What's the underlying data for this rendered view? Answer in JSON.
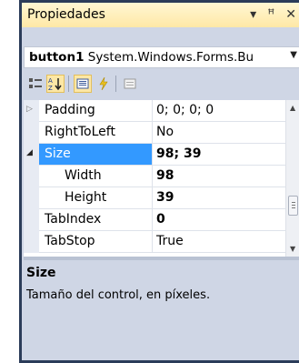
{
  "window": {
    "title": "Propiedades",
    "icons": [
      "dropdown-arrow-icon",
      "pin-icon",
      "close-icon"
    ]
  },
  "object_selector": {
    "name": "button1",
    "type": "System.Windows.Forms.Bu"
  },
  "toolbar": {
    "buttons": [
      "categorized-icon",
      "alphabetical-icon",
      "properties-icon",
      "events-icon",
      "property-pages-icon"
    ]
  },
  "properties": [
    {
      "name": "Padding",
      "value": "0; 0; 0; 0",
      "expander": "closed",
      "bold": false,
      "selected": false,
      "indent": 0
    },
    {
      "name": "RightToLeft",
      "value": "No",
      "expander": "",
      "bold": false,
      "selected": false,
      "indent": 0
    },
    {
      "name": "Size",
      "value": "98; 39",
      "expander": "open",
      "bold": true,
      "selected": true,
      "indent": 0
    },
    {
      "name": "Width",
      "value": "98",
      "expander": "",
      "bold": true,
      "selected": false,
      "indent": 1
    },
    {
      "name": "Height",
      "value": "39",
      "expander": "",
      "bold": true,
      "selected": false,
      "indent": 1
    },
    {
      "name": "TabIndex",
      "value": "0",
      "expander": "",
      "bold": true,
      "selected": false,
      "indent": 0
    },
    {
      "name": "TabStop",
      "value": "True",
      "expander": "",
      "bold": false,
      "selected": false,
      "indent": 0
    }
  ],
  "description": {
    "title": "Size",
    "text": "Tamaño del control, en píxeles."
  },
  "colors": {
    "frame": "#2b3c59",
    "titlebar": "#ffe8a6",
    "selection": "#3399ff",
    "panel": "#cfd6e5"
  }
}
